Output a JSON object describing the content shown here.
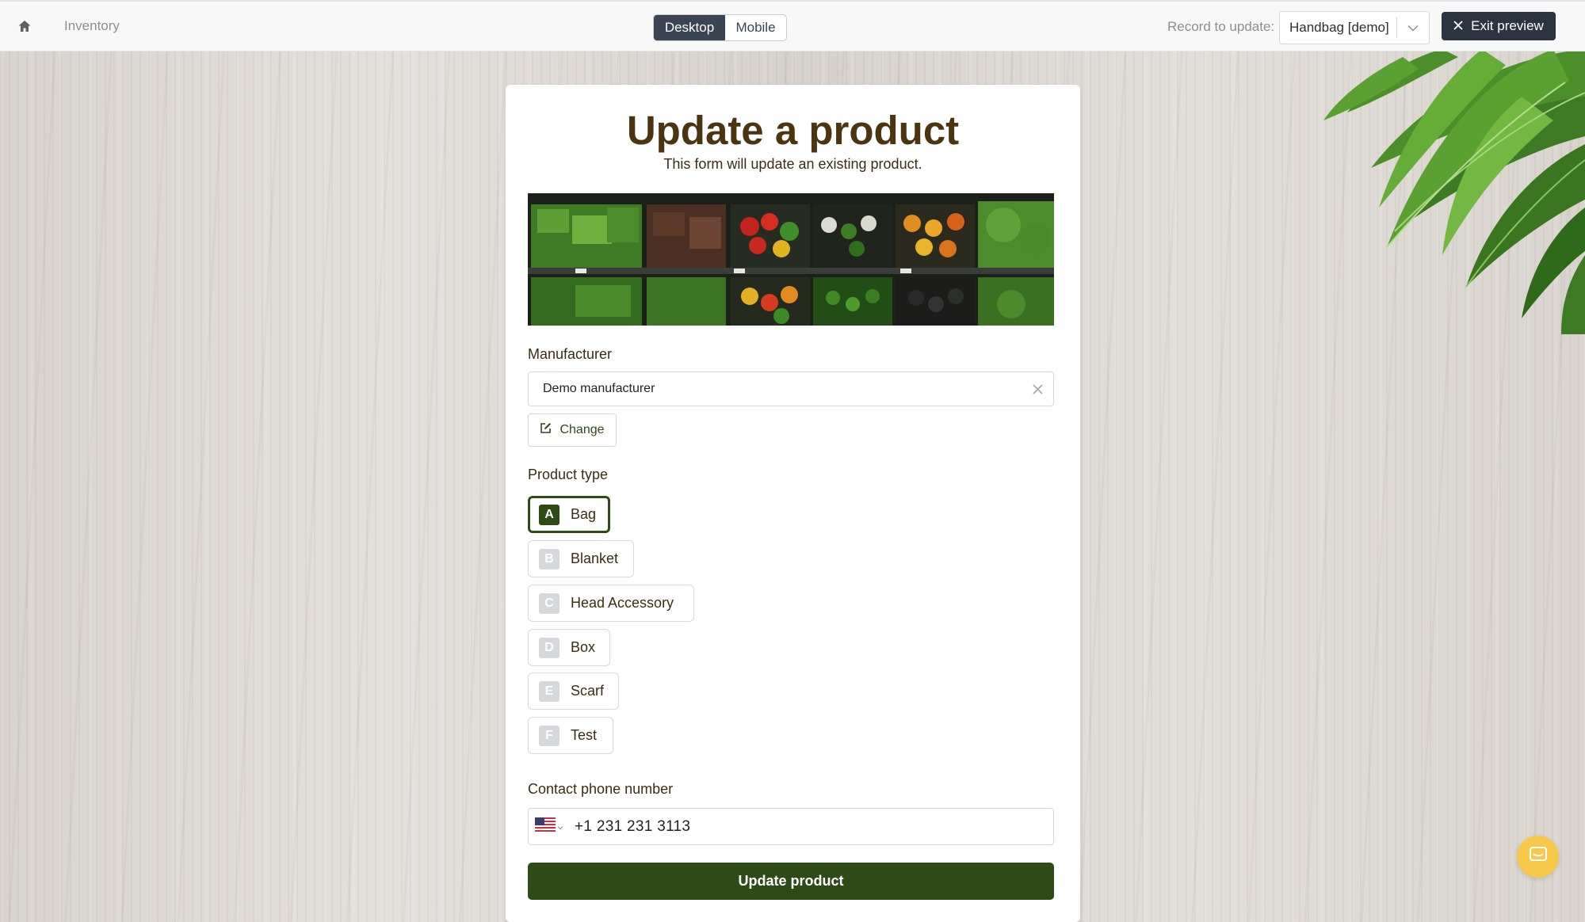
{
  "topbar": {
    "breadcrumb": "Inventory",
    "view_modes": [
      "Desktop",
      "Mobile"
    ],
    "active_view": "Desktop",
    "record_label": "Record to update:",
    "record_value": "Handbag [demo]",
    "exit_label": "Exit preview"
  },
  "form": {
    "title": "Update a product",
    "subtitle": "This form will update an existing product.",
    "manufacturer": {
      "label": "Manufacturer",
      "value": "Demo manufacturer",
      "change_label": "Change"
    },
    "product_type": {
      "label": "Product type",
      "options": [
        {
          "key": "A",
          "label": "Bag",
          "selected": true
        },
        {
          "key": "B",
          "label": "Blanket",
          "selected": false
        },
        {
          "key": "C",
          "label": "Head Accessory",
          "selected": false
        },
        {
          "key": "D",
          "label": "Box",
          "selected": false
        },
        {
          "key": "E",
          "label": "Scarf",
          "selected": false
        },
        {
          "key": "F",
          "label": "Test",
          "selected": false
        }
      ]
    },
    "phone": {
      "label": "Contact phone number",
      "country_flag": "us-flag-icon",
      "value": "+1 231 231 3113"
    },
    "submit_label": "Update product"
  },
  "colors": {
    "brand_green": "#2d4a17",
    "title_brown": "#4a3510",
    "dark_button": "#2b3440",
    "chat_yellow": "#f8c84a"
  }
}
